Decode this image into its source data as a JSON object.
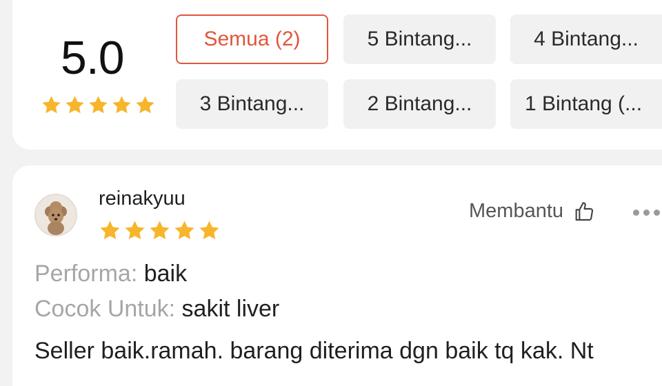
{
  "summary": {
    "score": "5.0",
    "star_count": 5,
    "star_color": "#f7b52b"
  },
  "filters": {
    "all": "Semua (2)",
    "five": "5 Bintang...",
    "four": "4 Bintang...",
    "three": "3 Bintang...",
    "two": "2 Bintang...",
    "one": "1 Bintang (..."
  },
  "accent_color": "#e0563b",
  "review": {
    "username": "reinakyuu",
    "rating": 5,
    "helpful_label": "Membantu",
    "performance_label": "Performa:",
    "performance_value": "baik",
    "suitable_label": "Cocok Untuk:",
    "suitable_value": "sakit liver",
    "text": "Seller baik.ramah. barang diterima dgn baik tq kak. Nt"
  }
}
